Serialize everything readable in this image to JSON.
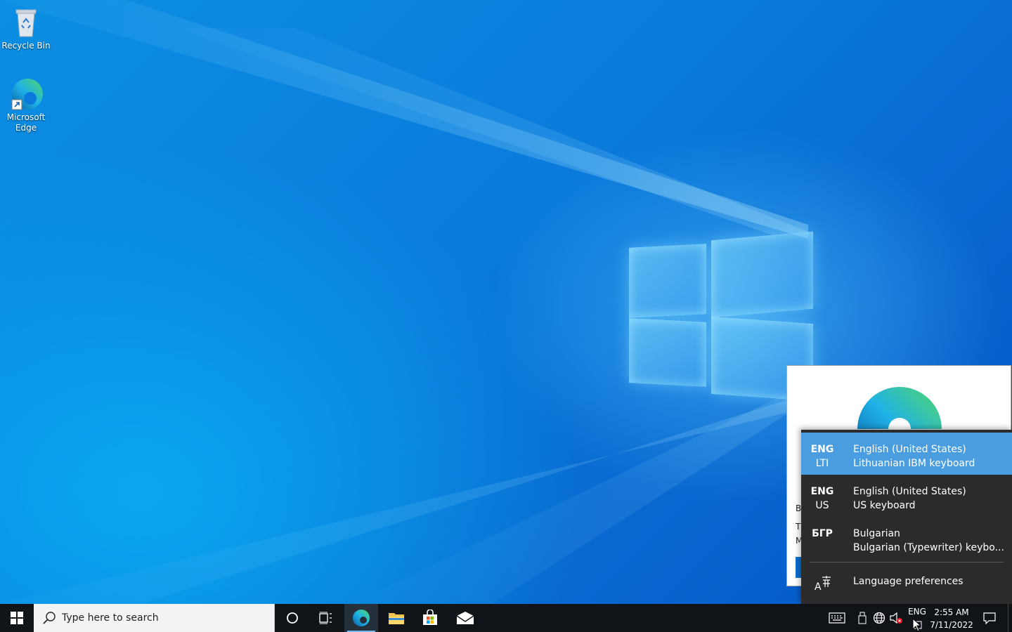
{
  "desktop": {
    "icons": [
      {
        "label": "Recycle Bin",
        "icon": "recycle-bin-icon"
      },
      {
        "label": "Microsoft Edge",
        "icon": "edge-icon"
      }
    ]
  },
  "edge_popup": {
    "partial_lines": [
      "B",
      "T",
      "M"
    ]
  },
  "language_flyout": {
    "items": [
      {
        "code": "ENG",
        "sub": "LTI",
        "language": "English (United States)",
        "keyboard": "Lithuanian IBM keyboard",
        "selected": true
      },
      {
        "code": "ENG",
        "sub": "US",
        "language": "English (United States)",
        "keyboard": "US keyboard",
        "selected": false
      },
      {
        "code": "БГР",
        "sub": "",
        "language": "Bulgarian",
        "keyboard": "Bulgarian (Typewriter) keybo...",
        "selected": false
      }
    ],
    "preferences_label": "Language preferences"
  },
  "taskbar": {
    "search_placeholder": "Type here to search",
    "pinned": [
      "cortana-icon",
      "task-view-icon",
      "edge-icon",
      "file-explorer-icon",
      "store-icon",
      "mail-icon"
    ],
    "tray": {
      "input_indicator": "ENG",
      "time": "2:55 AM",
      "date": "7/11/2022"
    }
  },
  "colors": {
    "flyout_bg": "#2b2b2b",
    "selected_bg": "#4a9ee0",
    "taskbar_bg": "#101418"
  }
}
